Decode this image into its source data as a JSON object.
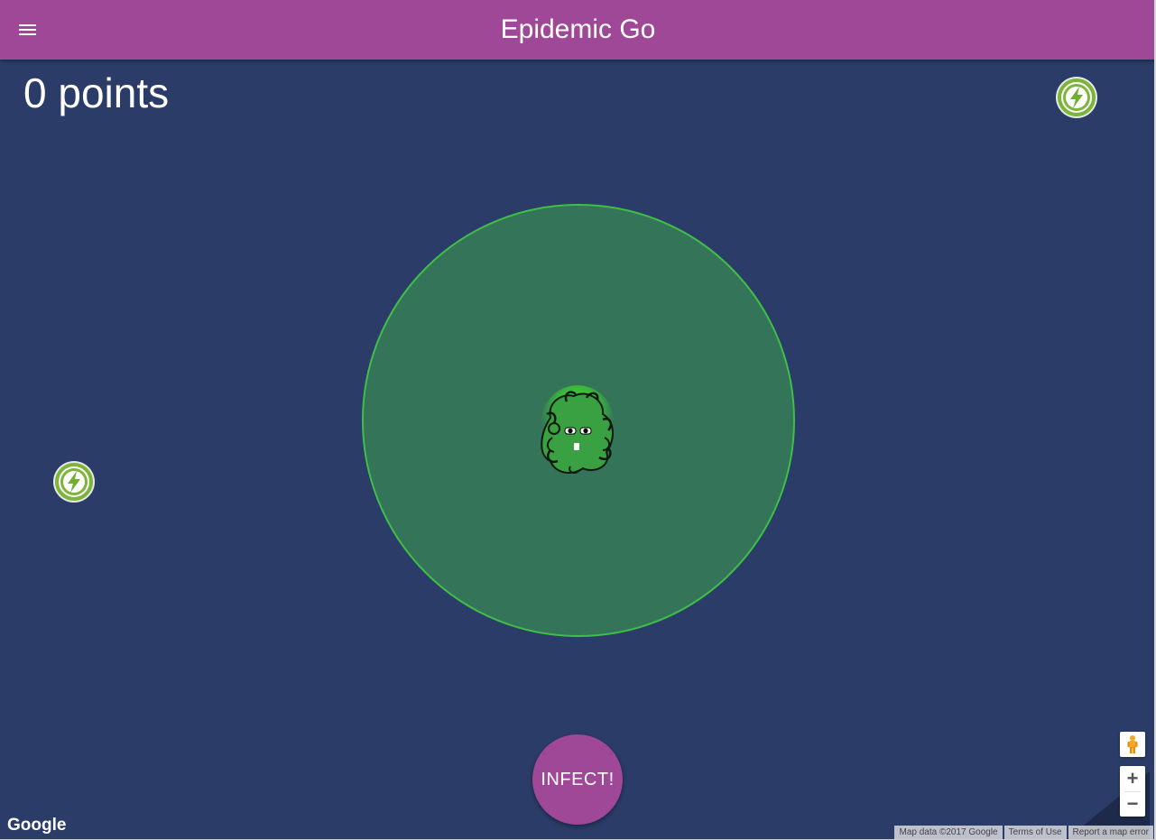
{
  "app": {
    "title": "Epidemic Go",
    "menu_icon": "hamburger-menu-icon"
  },
  "score": {
    "text": "0 points"
  },
  "powerups": [
    {
      "icon": "lightning-bolt-icon"
    },
    {
      "icon": "lightning-bolt-icon"
    }
  ],
  "player": {
    "icon": "germ-avatar-icon"
  },
  "actions": {
    "infect_label": "INFECT!"
  },
  "map": {
    "google_logo": "Google",
    "attribution": "Map data ©2017 Google",
    "terms": "Terms of Use",
    "report": "Report a map error",
    "zoom_in": "+",
    "zoom_out": "−",
    "pegman_icon": "pegman-icon"
  },
  "colors": {
    "header": "#a04898",
    "map_background": "#2b3c68",
    "infection_zone": "#347459",
    "infection_border": "#3fbf47",
    "infect_button": "#a04898",
    "powerup_bolt": "#6fae2e"
  }
}
